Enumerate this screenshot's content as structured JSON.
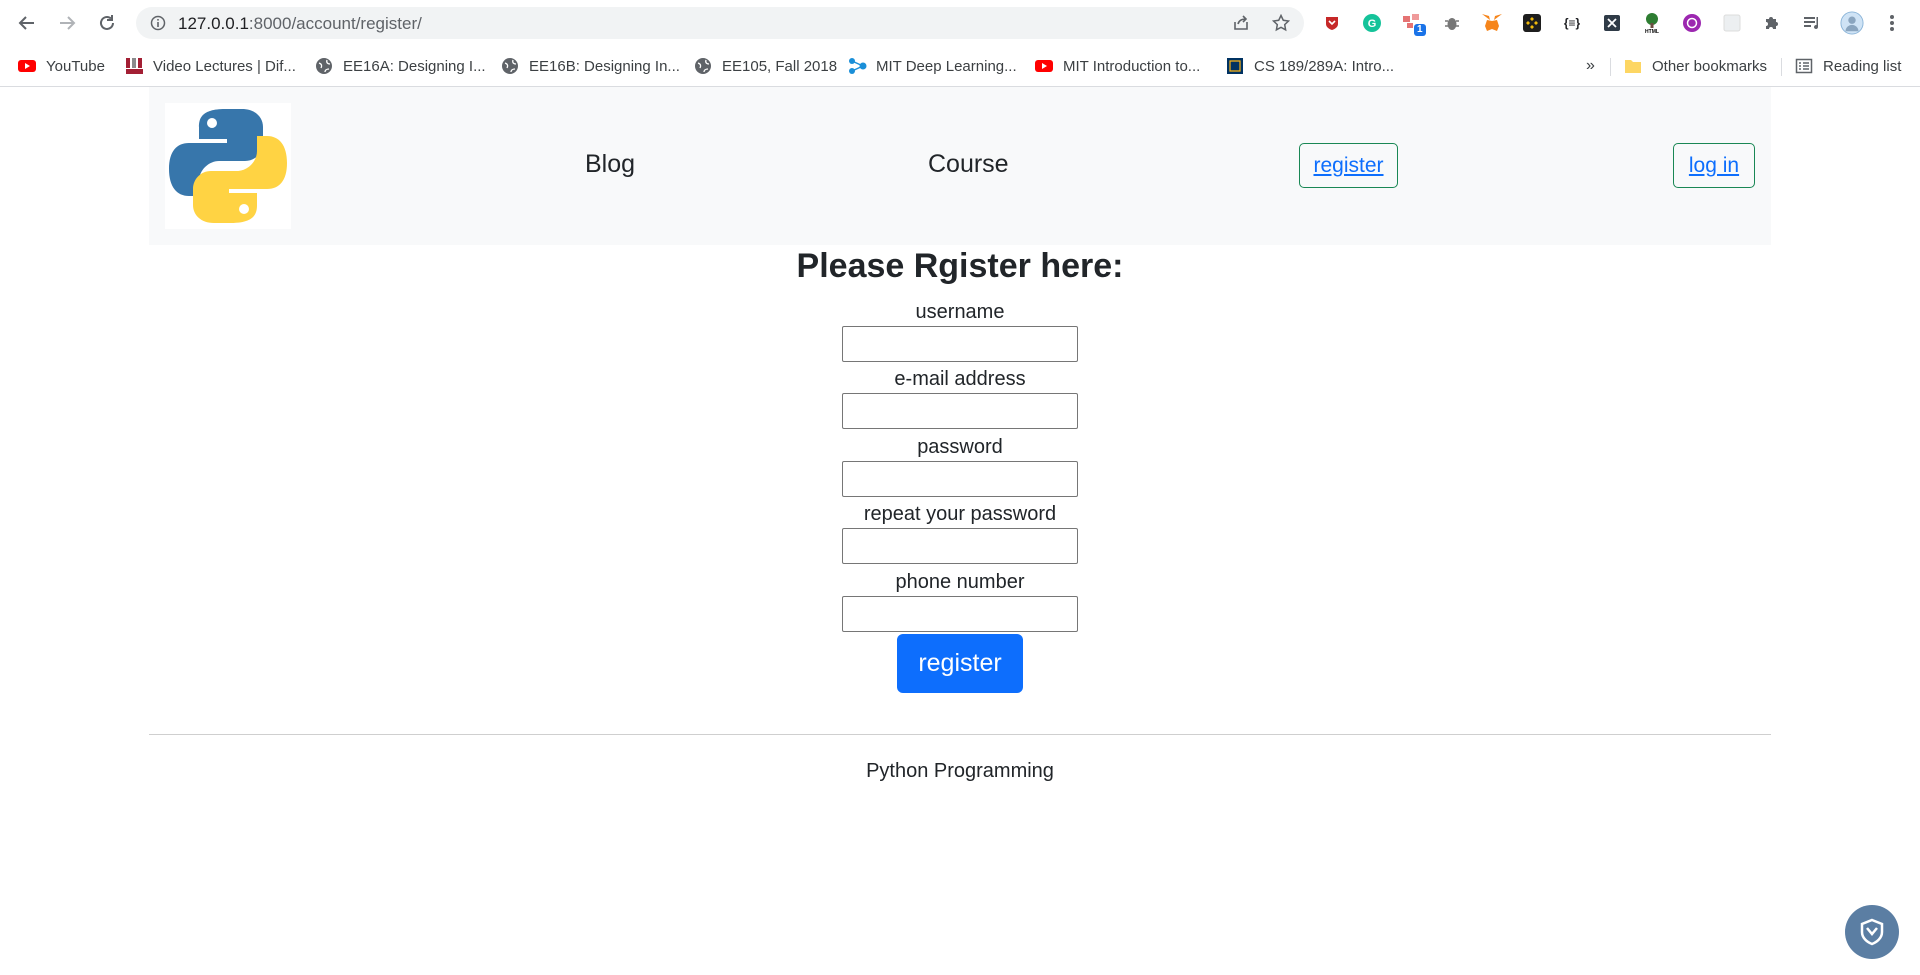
{
  "browser": {
    "url_host": "127.0.0.1",
    "url_rest": ":8000/account/register/",
    "bookmarks": [
      {
        "label": "YouTube"
      },
      {
        "label": "Video Lectures | Dif..."
      },
      {
        "label": "EE16A: Designing I..."
      },
      {
        "label": "EE16B: Designing In..."
      },
      {
        "label": "EE105, Fall 2018"
      },
      {
        "label": "MIT Deep Learning..."
      },
      {
        "label": "MIT Introduction to..."
      },
      {
        "label": "CS 189/289A: Intro..."
      }
    ],
    "overflow": "»",
    "other_bookmarks": "Other bookmarks",
    "reading_list": "Reading list",
    "extension_badge": "1"
  },
  "nav": {
    "blog": "Blog",
    "course": "Course",
    "register": "register",
    "login": "log in"
  },
  "form": {
    "title": "Please Rgister here:",
    "fields": [
      {
        "label": "username",
        "value": ""
      },
      {
        "label": "e-mail address",
        "value": ""
      },
      {
        "label": "password",
        "value": ""
      },
      {
        "label": "repeat your password",
        "value": ""
      },
      {
        "label": "phone number",
        "value": ""
      }
    ],
    "submit": "register"
  },
  "footer": {
    "text": "Python Programming"
  },
  "colors": {
    "primary": "#0d6efd",
    "nav_border": "#198754",
    "navbar_bg": "#f8f9fa"
  }
}
